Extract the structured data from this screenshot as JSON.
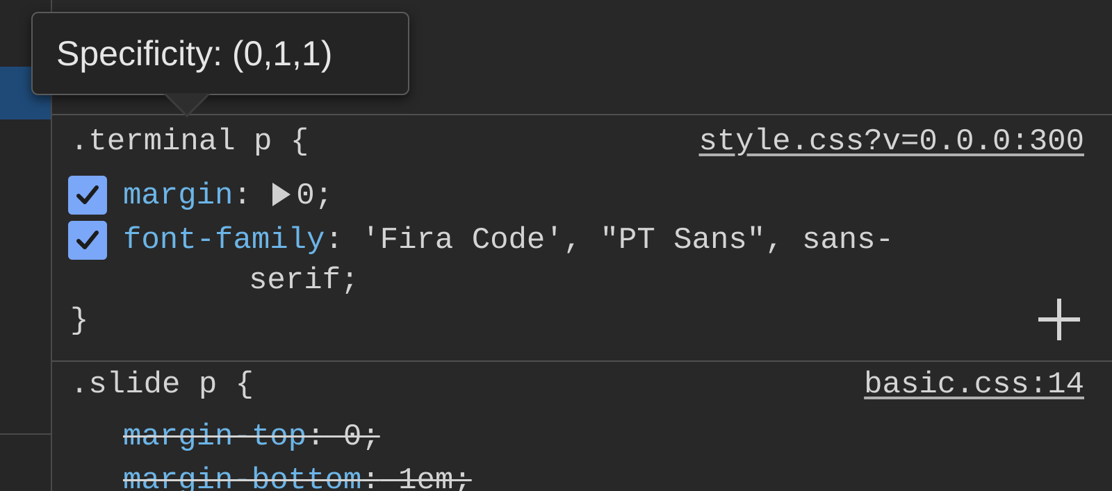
{
  "tooltip": {
    "text": "Specificity: (0,1,1)"
  },
  "rules": [
    {
      "selector": ".terminal p {",
      "source": "style.css?v=0.0.0:300",
      "closing": "}",
      "declarations": [
        {
          "property": "margin",
          "colon": ":",
          "value": "0;",
          "enabled": true,
          "expandable": true
        },
        {
          "property": "font-family",
          "colon": ":",
          "value": "'Fira Code', \"PT Sans\", sans-",
          "value_wrap": "serif;",
          "enabled": true
        }
      ]
    },
    {
      "selector": ".slide p {",
      "source": "basic.css:14",
      "declarations": [
        {
          "property": "margin-top",
          "colon": ":",
          "value": " 0;",
          "overridden": true
        },
        {
          "property": "margin-bottom",
          "colon": ":",
          "value": " 1em;",
          "overridden": true
        }
      ]
    }
  ],
  "colors": {
    "background": "#282828",
    "property_name": "#6cb5e8",
    "checkbox": "#7aa7f7",
    "selected_row": "#1f4a78"
  },
  "icons": [
    "checkmark-icon",
    "expand-triangle-icon",
    "add-icon"
  ]
}
